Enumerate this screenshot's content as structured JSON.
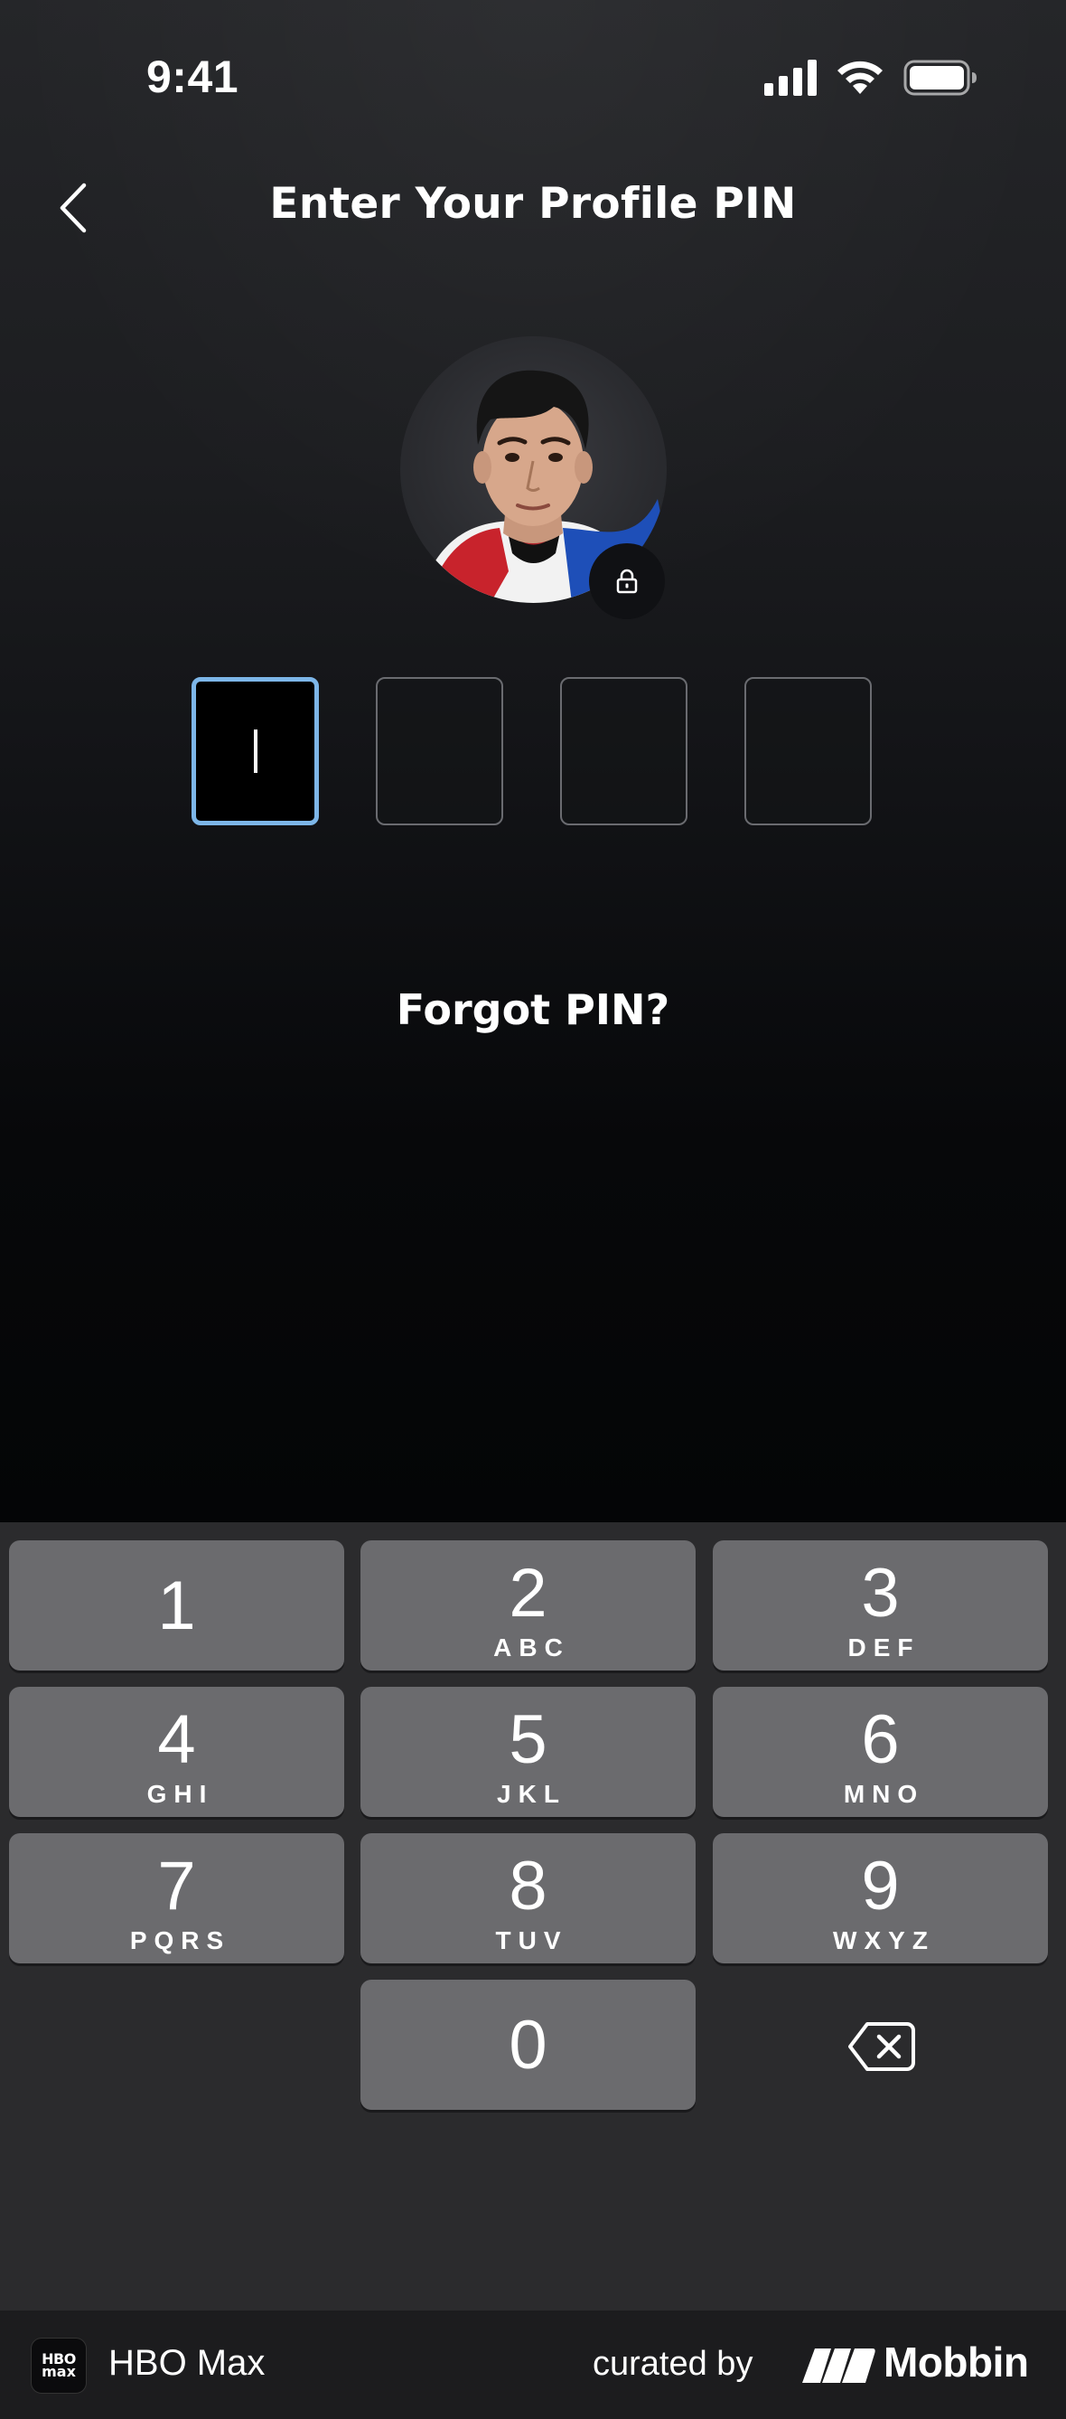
{
  "status_bar": {
    "time": "9:41"
  },
  "header": {
    "title": "Enter Your Profile PIN",
    "back_icon": "chevron-left-icon"
  },
  "profile": {
    "avatar": "profile-avatar-photo",
    "badge_icon": "lock-icon"
  },
  "pin": {
    "length": 4,
    "active_index": 0,
    "entered": ""
  },
  "links": {
    "forgot_pin": "Forgot PIN?"
  },
  "keypad": {
    "keys": [
      {
        "digit": "1",
        "letters": ""
      },
      {
        "digit": "2",
        "letters": "ABC"
      },
      {
        "digit": "3",
        "letters": "DEF"
      },
      {
        "digit": "4",
        "letters": "GHI"
      },
      {
        "digit": "5",
        "letters": "JKL"
      },
      {
        "digit": "6",
        "letters": "MNO"
      },
      {
        "digit": "7",
        "letters": "PQRS"
      },
      {
        "digit": "8",
        "letters": "TUV"
      },
      {
        "digit": "9",
        "letters": "WXYZ"
      },
      {
        "digit": "0",
        "letters": ""
      }
    ],
    "delete_icon": "backspace-icon"
  },
  "footer": {
    "app_logo_line1": "HBO",
    "app_logo_line2": "max",
    "app_name": "HBO Max",
    "curated_by": "curated by",
    "brand": "Mobbin"
  },
  "colors": {
    "accent": "#7db6e8",
    "key_bg": "#6b6b6e",
    "keypad_bg": "#2b2b2d"
  }
}
